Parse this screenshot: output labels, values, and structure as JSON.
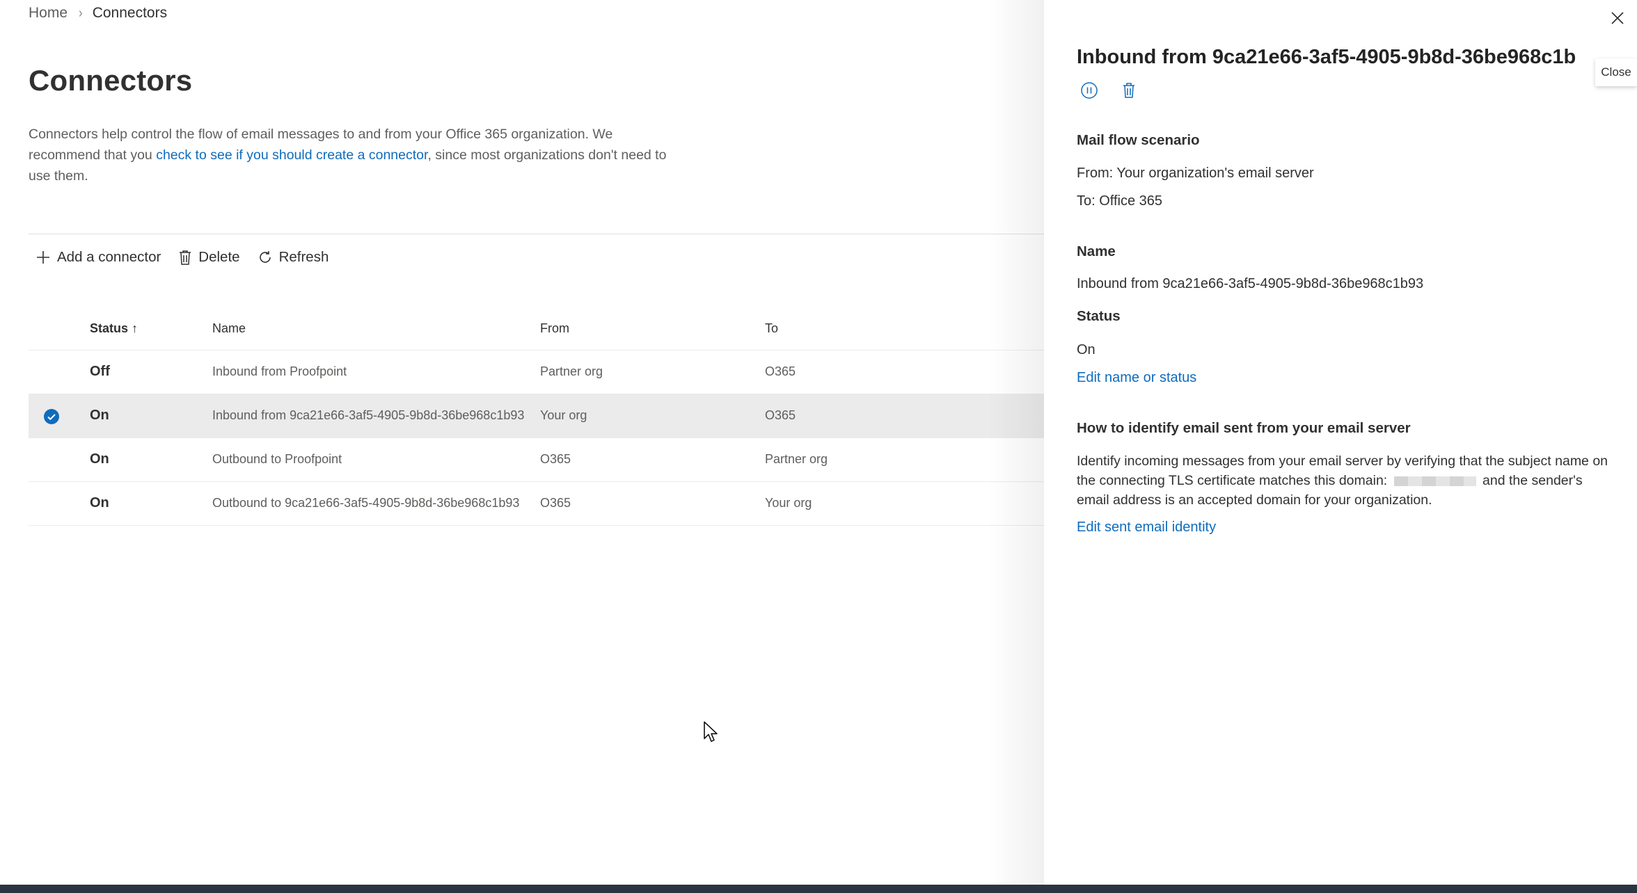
{
  "breadcrumb": {
    "home": "Home",
    "separator": "›",
    "current": "Connectors"
  },
  "page": {
    "title": "Connectors",
    "description_pre": "Connectors help control the flow of email messages to and from your Office 365 organization. We recommend that you ",
    "description_link": "check to see if you should create a connector",
    "description_post": ", since most organizations don't need to use them."
  },
  "toolbar": {
    "add_label": "Add a connector",
    "delete_label": "Delete",
    "refresh_label": "Refresh"
  },
  "table": {
    "headers": {
      "status": "Status",
      "status_sort": "↑",
      "name": "Name",
      "from": "From",
      "to": "To"
    },
    "rows": [
      {
        "status": "Off",
        "name": "Inbound from Proofpoint",
        "from": "Partner org",
        "to": "O365",
        "selected": false
      },
      {
        "status": "On",
        "name": "Inbound from 9ca21e66-3af5-4905-9b8d-36be968c1b93",
        "from": "Your org",
        "to": "O365",
        "selected": true
      },
      {
        "status": "On",
        "name": "Outbound to Proofpoint",
        "from": "O365",
        "to": "Partner org",
        "selected": false
      },
      {
        "status": "On",
        "name": "Outbound to 9ca21e66-3af5-4905-9b8d-36be968c1b93",
        "from": "O365",
        "to": "Your org",
        "selected": false
      }
    ]
  },
  "panel": {
    "title": "Inbound from 9ca21e66-3af5-4905-9b8d-36be968c1b",
    "close_tooltip": "Close",
    "mail_flow": {
      "heading": "Mail flow scenario",
      "from": "From: Your organization's email server",
      "to": "To: Office 365"
    },
    "name": {
      "heading": "Name",
      "value": "Inbound from 9ca21e66-3af5-4905-9b8d-36be968c1b93"
    },
    "status": {
      "heading": "Status",
      "value": "On",
      "edit_link": "Edit name or status"
    },
    "identify": {
      "heading": "How to identify email sent from your email server",
      "text_pre": "Identify incoming messages from your email server by verifying that the subject name on the connecting TLS certificate matches this domain: ",
      "text_post": " and the sender's email address is an accepted domain for your organization.",
      "edit_link": "Edit sent email identity"
    }
  },
  "colors": {
    "link": "#0f6cbd",
    "selected_row": "#ebebeb",
    "check": "#0f6cbd",
    "taskbar": "#2b3441"
  },
  "icons": {
    "add": "plus-icon",
    "delete": "trash-icon",
    "refresh": "refresh-icon",
    "check": "checkmark-circle-icon",
    "close": "close-icon",
    "disable": "pause-circle-icon",
    "panel_delete": "trash-icon",
    "cursor": "mouse-pointer-icon"
  }
}
